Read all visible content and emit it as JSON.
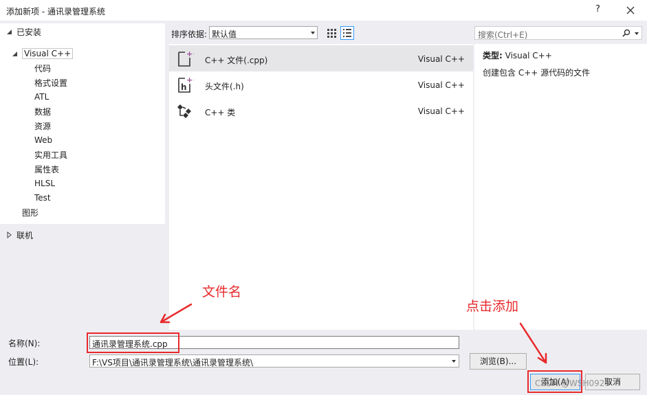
{
  "window": {
    "title": "添加新项 - 通讯录管理系统",
    "help": "?"
  },
  "tree": {
    "installed": "已安装",
    "visual_cpp": "Visual C++",
    "children": [
      "代码",
      "格式设置",
      "ATL",
      "数据",
      "资源",
      "Web",
      "实用工具",
      "属性表",
      "HLSL",
      "Test"
    ],
    "graphics": "图形",
    "online": "联机"
  },
  "toolbar": {
    "sort_label": "排序依据:",
    "sort_value": "默认值"
  },
  "search": {
    "placeholder": "搜索(Ctrl+E)"
  },
  "templates": [
    {
      "name": "C++ 文件(.cpp)",
      "lang": "Visual C++"
    },
    {
      "name": "头文件(.h)",
      "lang": "Visual C++"
    },
    {
      "name": "C++ 类",
      "lang": "Visual C++"
    }
  ],
  "details": {
    "type_label": "类型:",
    "type_value": "Visual C++",
    "description": "创建包含 C++ 源代码的文件"
  },
  "form": {
    "name_label": "名称(N):",
    "name_value": "通讯录管理系统.cpp",
    "location_label": "位置(L):",
    "location_value": "F:\\VS项目\\通讯录管理系统\\通讯录管理系统\\",
    "browse": "浏览(B)...",
    "add": "添加(A)",
    "cancel": "取消"
  },
  "annotations": {
    "filename": "文件名",
    "click_add": "点击添加",
    "color": "#e8282b"
  },
  "watermark": "CSDN @WSH0929"
}
